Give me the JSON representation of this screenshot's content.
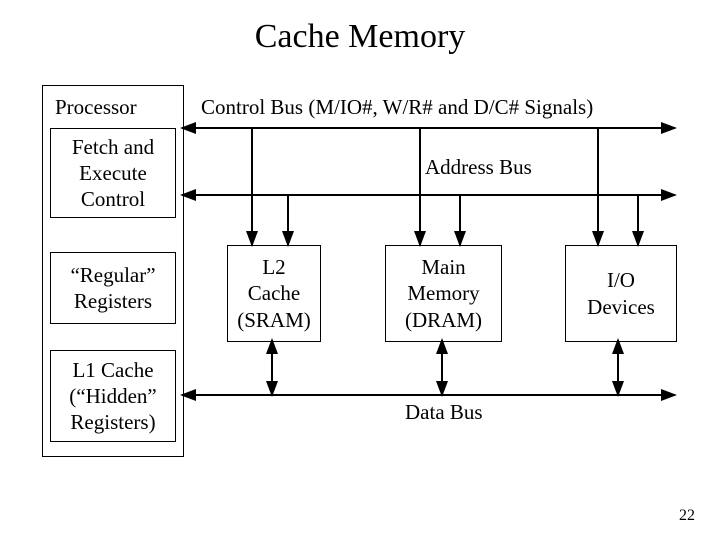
{
  "title": "Cache Memory",
  "processor": {
    "label": "Processor",
    "fetch": "Fetch and\nExecute\nControl",
    "regs": "“Regular”\nRegisters",
    "l1": "L1 Cache\n(“Hidden”\nRegisters)"
  },
  "buses": {
    "control": "Control Bus (M/IO#, W/R# and D/C# Signals)",
    "address": "Address Bus",
    "data": "Data Bus"
  },
  "blocks": {
    "l2": "L2\nCache\n(SRAM)",
    "main": "Main\nMemory\n(DRAM)",
    "io": "I/O\nDevices"
  },
  "page": "22"
}
